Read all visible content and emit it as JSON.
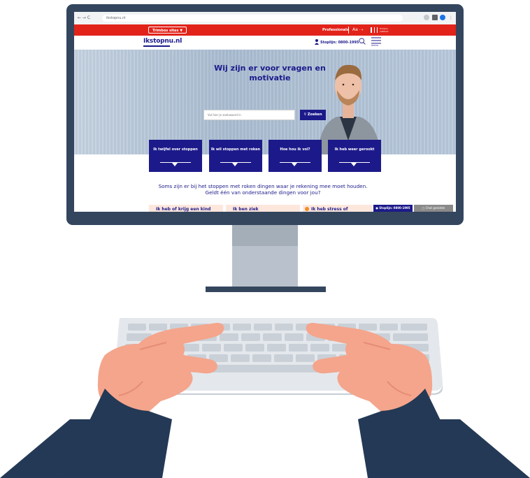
{
  "browser": {
    "url": "ikstopnu.nl",
    "nav_glyphs": "← → C"
  },
  "topbar": {
    "tabs_button": "Trimbos sites",
    "professionals": "Professionals",
    "text_size": "Aa",
    "org": "Trimbos instituut"
  },
  "header": {
    "logo": "Ikstopnu.nl",
    "stoplijn": "Stoplijn: 0800-1995",
    "menu_label": "menu"
  },
  "hero": {
    "title": "Wij zijn er voor vragen en motivatie",
    "search_placeholder": "Vul hier je zoekwoord in",
    "search_button": "Zoeken"
  },
  "cards": [
    {
      "label": "Ik twijfel over stoppen"
    },
    {
      "label": "Ik wil stoppen met roken"
    },
    {
      "label": "Hoe hou ik vol?"
    },
    {
      "label": "Ik heb weer gerookt"
    }
  ],
  "intro": {
    "text": "Soms zijn er bij het stoppen met roken dingen waar je rekening mee moet houden. Geldt één van onderstaande dingen voor jou?"
  },
  "bottom_cards": [
    {
      "label": "Ik heb of krijg een kind"
    },
    {
      "label": "Ik ben ziek"
    },
    {
      "label": "Ik heb stress of"
    }
  ],
  "floating": {
    "stoplijn": "Stoplijn: 0800-1995",
    "chat": "Chat gesloten"
  },
  "colors": {
    "brand_blue": "#1c1a8a",
    "brand_red": "#e2231a",
    "monitor": "#34465e",
    "skin": "#f4a58c",
    "sleeve": "#243955"
  }
}
